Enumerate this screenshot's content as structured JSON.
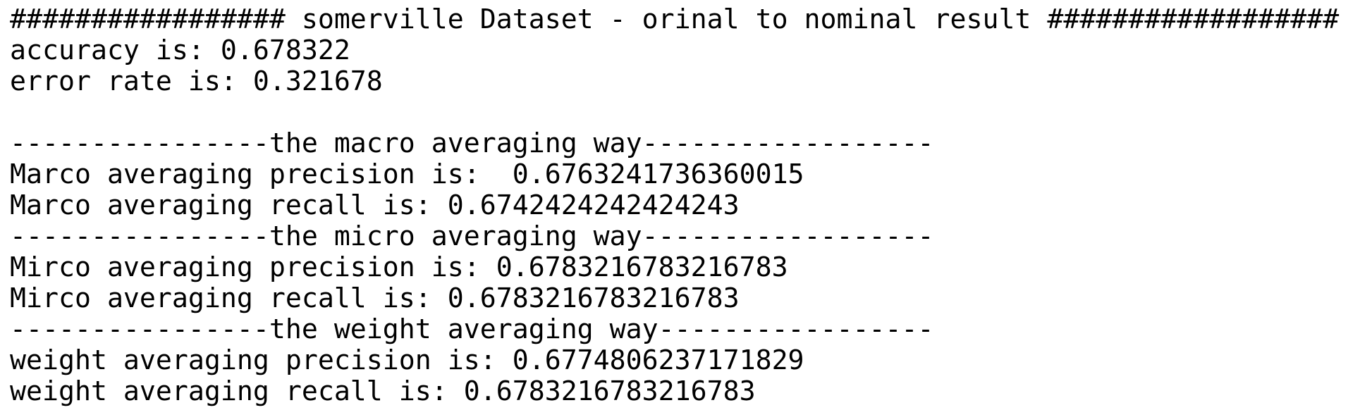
{
  "header": "################# somerville Dataset - orinal to nominal result ##################",
  "accuracy": "accuracy is: 0.678322",
  "error_rate": "error rate is: 0.321678",
  "macro": {
    "divider": "----------------the macro averaging way------------------",
    "precision": "Marco averaging precision is:  0.6763241736360015",
    "recall": "Marco averaging recall is: 0.6742424242424243"
  },
  "micro": {
    "divider": "----------------the micro averaging way------------------",
    "precision": "Mirco averaging precision is: 0.6783216783216783",
    "recall": "Mirco averaging recall is: 0.6783216783216783"
  },
  "weight": {
    "divider": "----------------the weight averaging way-----------------",
    "precision": "weight averaging precision is: 0.6774806237171829",
    "recall": "weight averaging recall is: 0.6783216783216783"
  }
}
